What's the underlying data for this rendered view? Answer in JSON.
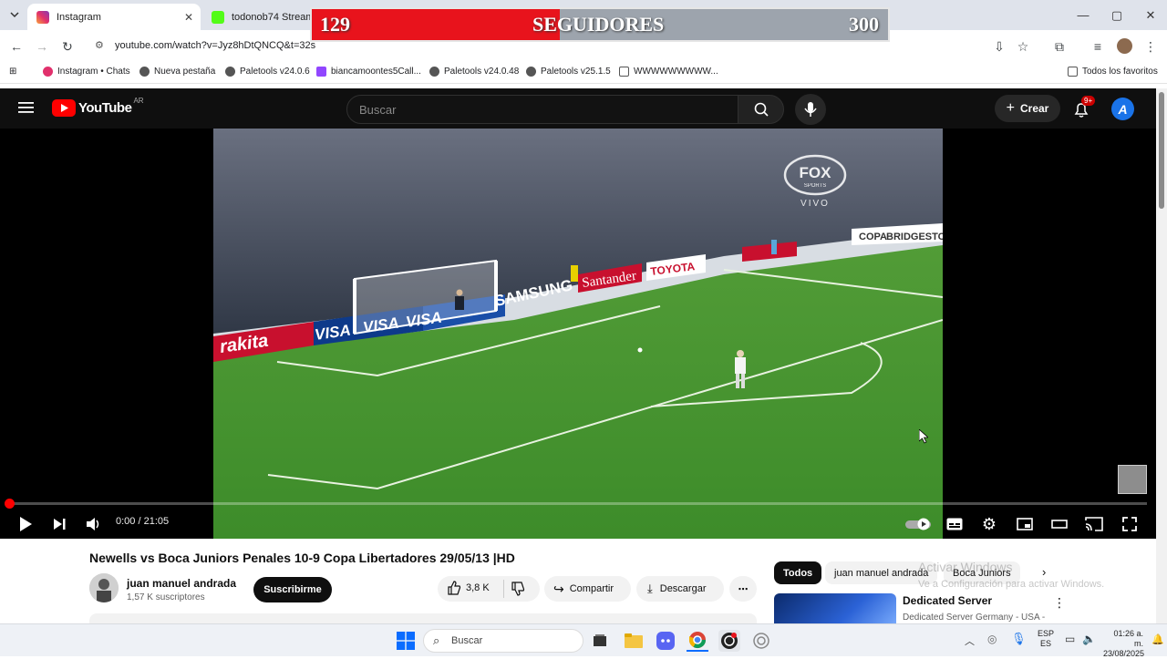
{
  "browser": {
    "tabs": [
      {
        "label": "Instagram",
        "active": true
      },
      {
        "label": "todonob74 Stream - \\"
      }
    ],
    "url": "youtube.com/watch?v=Jyz8hDtQNCQ&t=32s",
    "bookmarks": [
      "Instagram • Chats",
      "Nueva pestaña",
      "Paletools v24.0.6",
      "biancamoontes5Call...",
      "Paletools v24.0.48",
      "Paletools v25.1.5",
      "WWWWWWWWW..."
    ],
    "all_bookmarks": "Todos los favoritos"
  },
  "overlay": {
    "current": "129",
    "label": "SEGUIDORES",
    "goal": "300",
    "progress_fraction": 0.43
  },
  "youtube": {
    "logo": "YouTube",
    "region": "AR",
    "search_placeholder": "Buscar",
    "create_label": "Crear",
    "notif_badge": "9+",
    "avatar_letter": "A"
  },
  "video": {
    "overlay_logo_top": "FOX",
    "overlay_logo_bottom": "SPORTS",
    "live": "VIVO",
    "ads": [
      "Santander",
      "TOYOTA",
      "SAMSUNG",
      "VISA",
      "VISA",
      "VISA",
      "rakita",
      "BRIDGESTONE",
      "COPA"
    ],
    "timecode": "0:00 / 21:05"
  },
  "details": {
    "title": "Newells vs Boca Juniors Penales 10-9 Copa Libertadores 29/05/13 |HD",
    "channel": "juan manuel andrada",
    "subscribers": "1,57 K suscriptores",
    "subscribe": "Suscribirme",
    "likes": "3,8 K",
    "share": "Compartir",
    "download": "Descargar"
  },
  "sidebar": {
    "chips": [
      "Todos",
      "juan manuel andrada",
      "Boca Juniors"
    ],
    "rec_title": "Dedicated Server",
    "rec_sub": "Dedicated Server Germany - USA -",
    "watermark_1": "Activar Windows",
    "watermark_2": "Ve a Configuración para activar Windows."
  },
  "taskbar": {
    "search": "Buscar",
    "lang_1": "ESP",
    "lang_2": "ES",
    "time": "01:26 a. m.",
    "date": "23/08/2025"
  }
}
